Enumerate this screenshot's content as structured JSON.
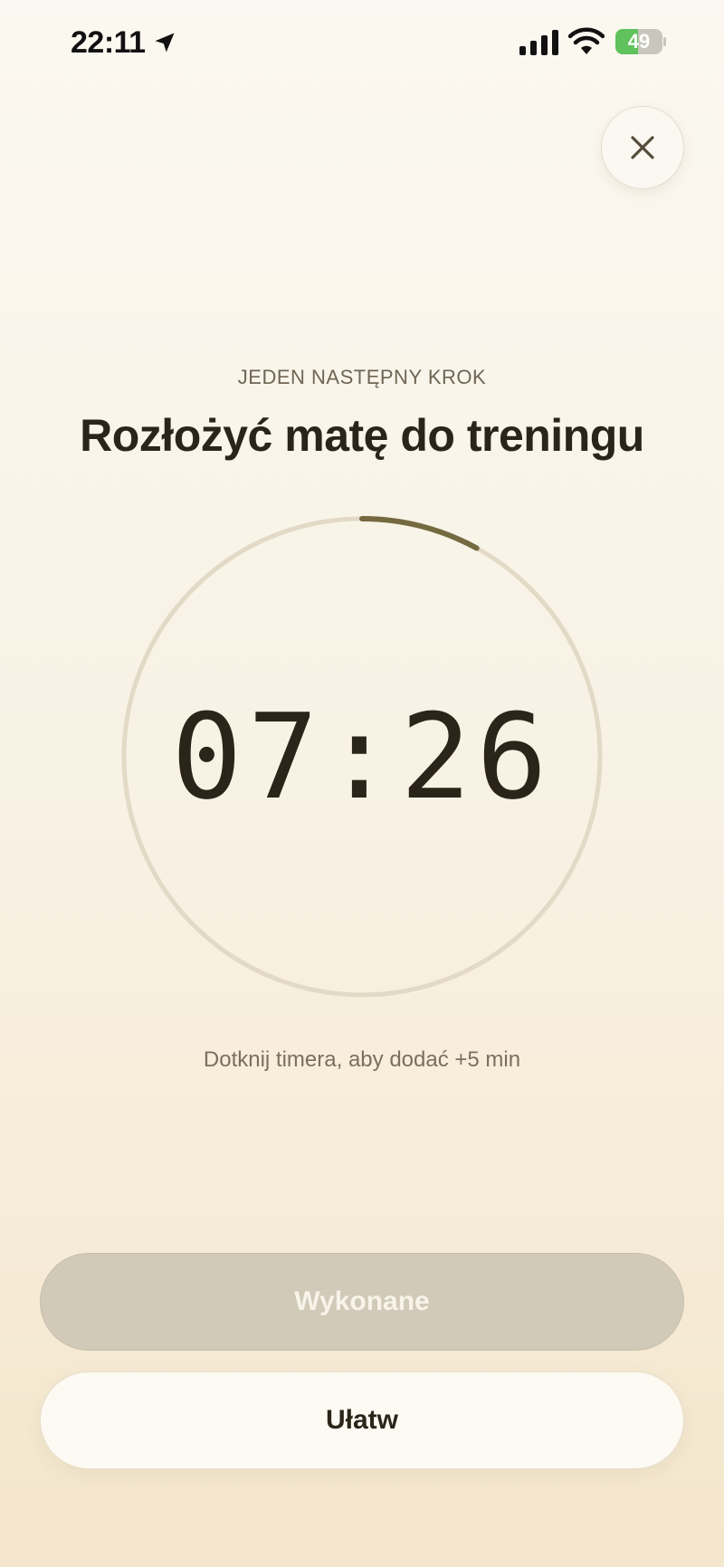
{
  "status_bar": {
    "time": "22:11",
    "battery_level": "49",
    "battery_fraction": 0.49,
    "icons": [
      "location-arrow-icon",
      "signal-icon",
      "wifi-icon",
      "battery-charging-icon"
    ]
  },
  "header": {
    "close_icon": "close-icon"
  },
  "main": {
    "eyebrow": "JEDEN NASTĘPNY KROK",
    "title": "Rozłożyć matę do treningu",
    "timer": {
      "display": "07:26",
      "progress_fraction": 0.08
    },
    "hint": "Dotknij timera, aby dodać +5 min"
  },
  "actions": {
    "done_label": "Wykonane",
    "easier_label": "Ułatw"
  },
  "colors": {
    "ring_track": "#e2d9c6",
    "ring_progress": "#75693f",
    "battery_green": "#5fc25c",
    "done_button": "#d2cab8"
  }
}
